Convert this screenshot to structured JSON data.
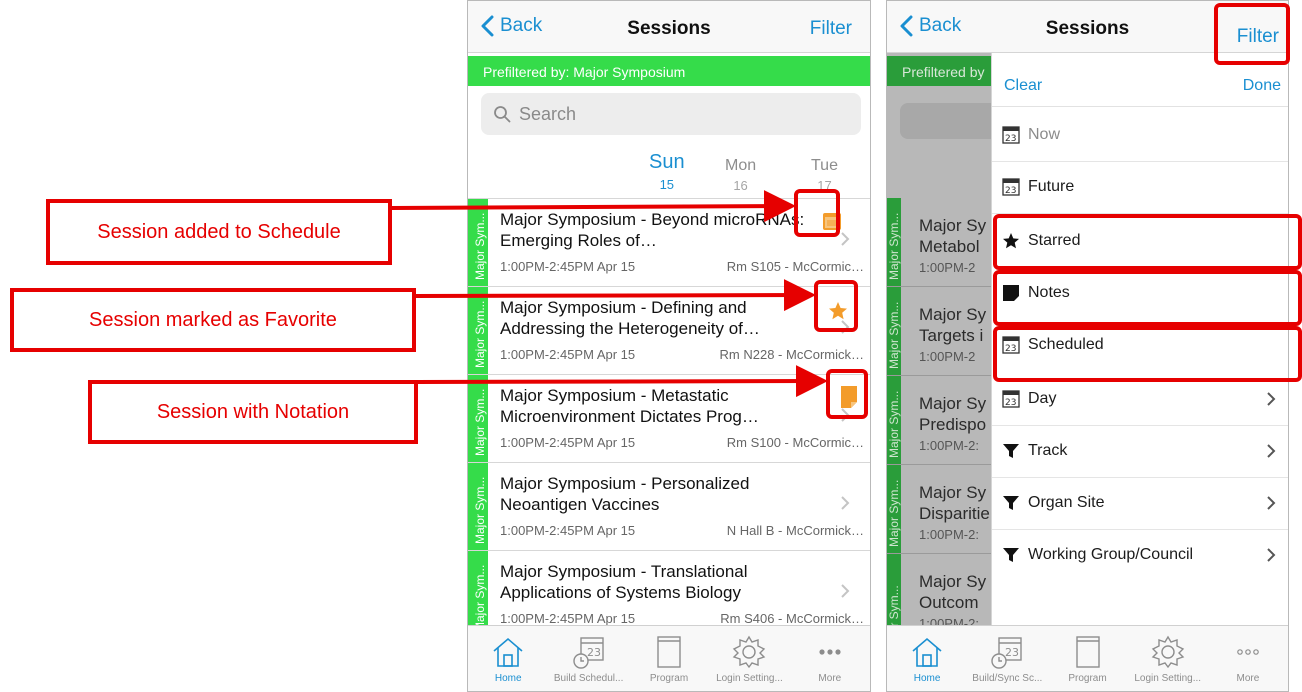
{
  "colors": {
    "accent": "#1a8fd1",
    "track_green": "#35dc4a",
    "star_orange": "#f39c2b",
    "annotation_red": "#e60000"
  },
  "left_screen": {
    "nav": {
      "back": "Back",
      "title": "Sessions",
      "filter": "Filter"
    },
    "prefilter": "Prefiltered by: Major Symposium",
    "search_placeholder": "Search",
    "days": [
      {
        "name": "Sun",
        "num": "15"
      },
      {
        "name": "Mon",
        "num": "16"
      },
      {
        "name": "Tue",
        "num": "17"
      }
    ],
    "sessions": [
      {
        "track": "Major Sym...",
        "title": "Major Symposium - Beyond microRNAs: Emerging Roles of…",
        "time": "1:00PM-2:45PM Apr 15",
        "room": "Rm S105 - McCormic…",
        "status_icon": "calendar-icon"
      },
      {
        "track": "Major Sym...",
        "title": "Major Symposium - Defining and Addressing the Heterogeneity of…",
        "time": "1:00PM-2:45PM Apr 15",
        "room": "Rm N228 - McCormick…",
        "status_icon": "star-icon"
      },
      {
        "track": "Major Sym...",
        "title": "Major Symposium - Metastatic Microenvironment Dictates Prog…",
        "time": "1:00PM-2:45PM Apr 15",
        "room": "Rm S100 - McCormic…",
        "status_icon": "note-icon"
      },
      {
        "track": "Major Sym...",
        "title": "Major Symposium - Personalized Neoantigen Vaccines",
        "time": "1:00PM-2:45PM Apr 15",
        "room": "N Hall B - McCormick…",
        "status_icon": ""
      },
      {
        "track": "Major Sym...",
        "title": "Major Symposium - Translational Applications of Systems Biology",
        "time": "1:00PM-2:45PM Apr 15",
        "room": "Rm S406 - McCormick…",
        "status_icon": ""
      }
    ],
    "tabs": [
      "Home",
      "Build Schedul...",
      "Program",
      "Login Setting...",
      "More"
    ]
  },
  "right_screen": {
    "nav": {
      "back": "Back",
      "title": "Sessions",
      "filter": "Filter"
    },
    "prefilter_partial": "Prefiltered by",
    "bg_rows": [
      {
        "track": "Major Sym...",
        "title": "Major Sy",
        "title2": "Metabol",
        "time": "1:00PM-2"
      },
      {
        "track": "Major Sym...",
        "title": "Major Sy",
        "title2": "Targets i",
        "time": "1:00PM-2"
      },
      {
        "track": "Major Sym...",
        "title": "Major Sy",
        "title2": "Predispo",
        "time": "1:00PM-2:"
      },
      {
        "track": "Major Sym...",
        "title": "Major Sy",
        "title2": "Disparitie",
        "time": "1:00PM-2:"
      },
      {
        "track": "jor Sym...",
        "title": "Major Sy",
        "title2": "Outcom",
        "time": "1:00PM-2:"
      }
    ],
    "panel": {
      "clear": "Clear",
      "done": "Done",
      "items": [
        {
          "label": "Now",
          "icon": "calendar-icon"
        },
        {
          "label": "Future",
          "icon": "calendar-icon"
        },
        {
          "label": "Starred",
          "icon": "star-icon"
        },
        {
          "label": "Notes",
          "icon": "note-icon"
        },
        {
          "label": "Scheduled",
          "icon": "calendar-icon"
        },
        {
          "label": "Day",
          "icon": "calendar-icon"
        },
        {
          "label": "Track",
          "icon": "funnel-icon"
        },
        {
          "label": "Organ Site",
          "icon": "funnel-icon"
        },
        {
          "label": "Working Group/Council",
          "icon": "funnel-icon"
        }
      ]
    },
    "tabs": [
      "Home",
      "Build/Sync Sc...",
      "Program",
      "Login Setting...",
      "More"
    ]
  },
  "calendar_glyph": "23",
  "annotations": {
    "schedule": "Session added to Schedule",
    "favorite": "Session marked as Favorite",
    "notation": "Session with Notation"
  }
}
